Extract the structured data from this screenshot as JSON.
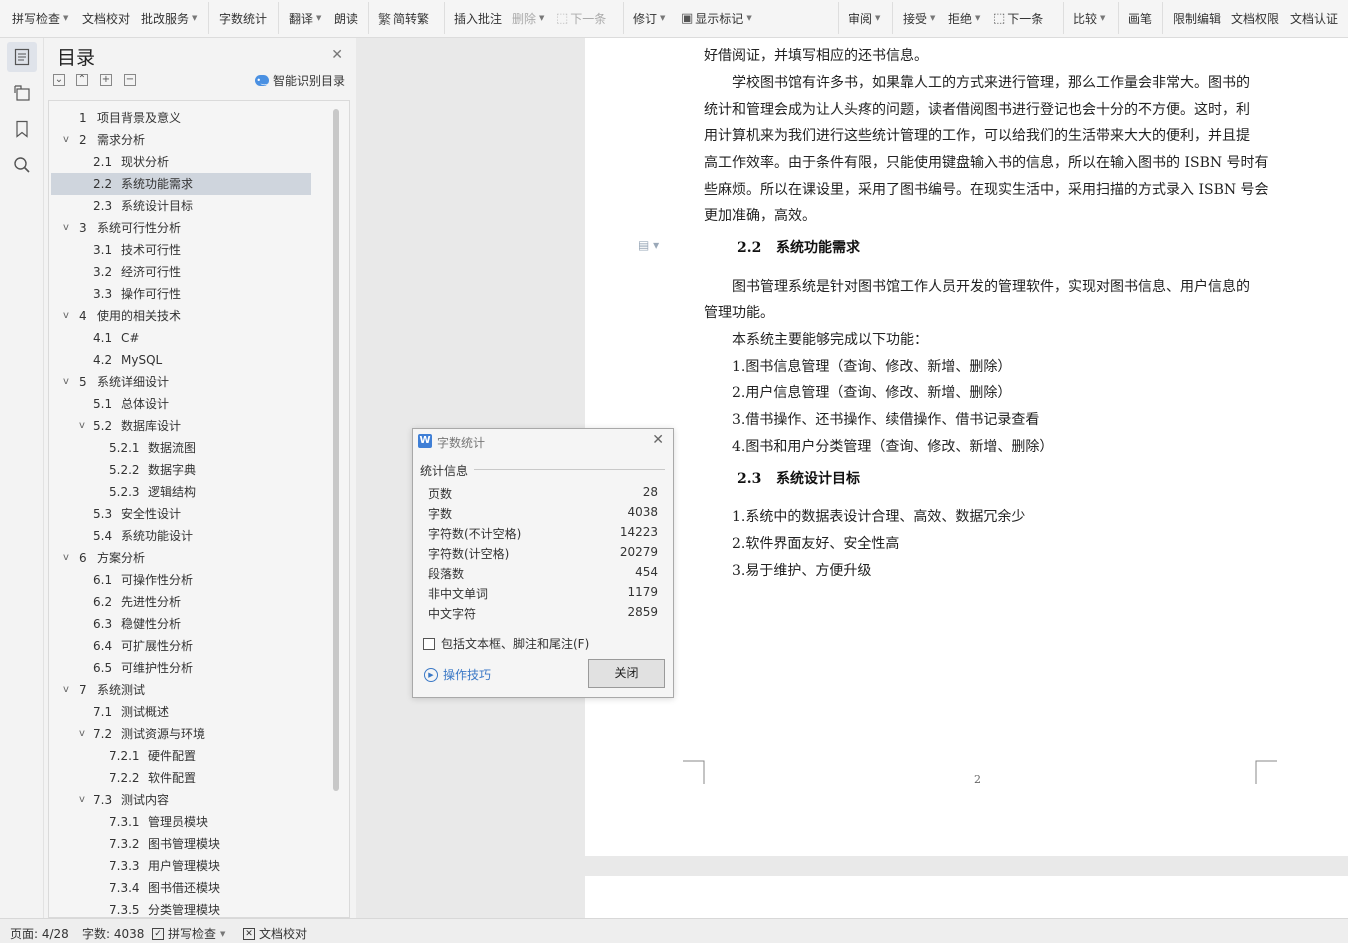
{
  "ribbon": {
    "spell_check": "拼写检查",
    "doc_proofread": "文档校对",
    "approval_service": "批改服务",
    "word_count": "字数统计",
    "translate": "翻译",
    "read_aloud": "朗读",
    "simp_trad": "简转繁",
    "insert_comment": "插入批注",
    "delete": "删除",
    "next_comment": "下一条",
    "revise": "修订",
    "show_marks": "显示标记",
    "review": "审阅",
    "accept": "接受",
    "reject": "拒绝",
    "next_change": "下一条",
    "compare": "比较",
    "pen": "画笔",
    "restrict_edit": "限制编辑",
    "doc_permission": "文档权限",
    "doc_certify": "文档认证"
  },
  "toc": {
    "title": "目录",
    "smart_detect": "智能识别目录",
    "items": [
      {
        "num": "1",
        "label": "项目背景及意义",
        "level": 1,
        "arrow": ""
      },
      {
        "num": "2",
        "label": "需求分析",
        "level": 1,
        "arrow": "v"
      },
      {
        "num": "2.1",
        "label": "现状分析",
        "level": 2,
        "arrow": ""
      },
      {
        "num": "2.2",
        "label": "系统功能需求",
        "level": 2,
        "arrow": ""
      },
      {
        "num": "2.3",
        "label": "系统设计目标",
        "level": 2,
        "arrow": ""
      },
      {
        "num": "3",
        "label": "系统可行性分析",
        "level": 1,
        "arrow": "v"
      },
      {
        "num": "3.1",
        "label": "技术可行性",
        "level": 2,
        "arrow": ""
      },
      {
        "num": "3.2",
        "label": "经济可行性",
        "level": 2,
        "arrow": ""
      },
      {
        "num": "3.3",
        "label": "操作可行性",
        "level": 2,
        "arrow": ""
      },
      {
        "num": "4",
        "label": "使用的相关技术",
        "level": 1,
        "arrow": "v"
      },
      {
        "num": "4.1",
        "label": "C#",
        "level": 2,
        "arrow": ""
      },
      {
        "num": "4.2",
        "label": "MySQL",
        "level": 2,
        "arrow": ""
      },
      {
        "num": "5",
        "label": "系统详细设计",
        "level": 1,
        "arrow": "v"
      },
      {
        "num": "5.1",
        "label": "总体设计",
        "level": 2,
        "arrow": ""
      },
      {
        "num": "5.2",
        "label": "数据库设计",
        "level": 2,
        "arrow": "v"
      },
      {
        "num": "5.2.1",
        "label": "数据流图",
        "level": 3,
        "arrow": ""
      },
      {
        "num": "5.2.2",
        "label": "数据字典",
        "level": 3,
        "arrow": ""
      },
      {
        "num": "5.2.3",
        "label": "逻辑结构",
        "level": 3,
        "arrow": ""
      },
      {
        "num": "5.3",
        "label": "安全性设计",
        "level": 2,
        "arrow": ""
      },
      {
        "num": "5.4",
        "label": "系统功能设计",
        "level": 2,
        "arrow": ""
      },
      {
        "num": "6",
        "label": "方案分析",
        "level": 1,
        "arrow": "v"
      },
      {
        "num": "6.1",
        "label": "可操作性分析",
        "level": 2,
        "arrow": ""
      },
      {
        "num": "6.2",
        "label": "先进性分析",
        "level": 2,
        "arrow": ""
      },
      {
        "num": "6.3",
        "label": "稳健性分析",
        "level": 2,
        "arrow": ""
      },
      {
        "num": "6.4",
        "label": "可扩展性分析",
        "level": 2,
        "arrow": ""
      },
      {
        "num": "6.5",
        "label": "可维护性分析",
        "level": 2,
        "arrow": ""
      },
      {
        "num": "7",
        "label": "系统测试",
        "level": 1,
        "arrow": "v"
      },
      {
        "num": "7.1",
        "label": "测试概述",
        "level": 2,
        "arrow": ""
      },
      {
        "num": "7.2",
        "label": "测试资源与环境",
        "level": 2,
        "arrow": "v"
      },
      {
        "num": "7.2.1",
        "label": "硬件配置",
        "level": 3,
        "arrow": ""
      },
      {
        "num": "7.2.2",
        "label": "软件配置",
        "level": 3,
        "arrow": ""
      },
      {
        "num": "7.3",
        "label": "测试内容",
        "level": 2,
        "arrow": "v"
      },
      {
        "num": "7.3.1",
        "label": "管理员模块",
        "level": 3,
        "arrow": ""
      },
      {
        "num": "7.3.2",
        "label": "图书管理模块",
        "level": 3,
        "arrow": ""
      },
      {
        "num": "7.3.3",
        "label": "用户管理模块",
        "level": 3,
        "arrow": ""
      },
      {
        "num": "7.3.4",
        "label": "图书借还模块",
        "level": 3,
        "arrow": ""
      },
      {
        "num": "7.3.5",
        "label": "分类管理模块",
        "level": 3,
        "arrow": ""
      }
    ],
    "selected_index": 3
  },
  "document": {
    "lines": [
      "好借阅证，并填写相应的还书信息。",
      "学校图书馆有许多书，如果靠人工的方式来进行管理，那么工作量会非常大。图书的",
      "统计和管理会成为让人头疼的问题，读者借阅图书进行登记也会十分的不方便。这时，利",
      "用计算机来为我们进行这些统计管理的工作，可以给我们的生活带来大大的便利，并且提",
      "高工作效率。由于条件有限，只能使用键盘输入书的信息，所以在输入图书的 ISBN 号时有",
      "些麻烦。所以在课设里，采用了图书编号。在现实生活中，采用扫描的方式录入 ISBN 号会",
      "更加准确，高效。"
    ],
    "heading_22_num": "2.2",
    "heading_22_text": "系统功能需求",
    "func_lines": [
      "图书管理系统是针对图书馆工作人员开发的管理软件，实现对图书信息、用户信息的",
      "管理功能。",
      "本系统主要能够完成以下功能：",
      "1.图书信息管理（查询、修改、新增、删除）",
      "2.用户信息管理（查询、修改、新增、删除）",
      "3.借书操作、还书操作、续借操作、借书记录查看",
      "4.图书和用户分类管理（查询、修改、新增、删除）"
    ],
    "heading_23_num": "2.3",
    "heading_23_text": "系统设计目标",
    "goal_lines": [
      "1.系统中的数据表设计合理、高效、数据冗余少",
      "2.软件界面友好、安全性高",
      "3.易于维护、方便升级"
    ],
    "page_number": "2"
  },
  "dialog": {
    "title": "字数统计",
    "section": "统计信息",
    "rows": [
      {
        "k": "页数",
        "v": "28"
      },
      {
        "k": "字数",
        "v": "4038"
      },
      {
        "k": "字符数(不计空格)",
        "v": "14223"
      },
      {
        "k": "字符数(计空格)",
        "v": "20279"
      },
      {
        "k": "段落数",
        "v": "454"
      },
      {
        "k": "非中文单词",
        "v": "1179"
      },
      {
        "k": "中文字符",
        "v": "2859"
      }
    ],
    "include_label": "包括文本框、脚注和尾注(F)",
    "tips": "操作技巧",
    "close": "关闭"
  },
  "status": {
    "page": "页面: 4/28",
    "words": "字数: 4038",
    "spell": "拼写检查",
    "proof": "文档校对"
  }
}
